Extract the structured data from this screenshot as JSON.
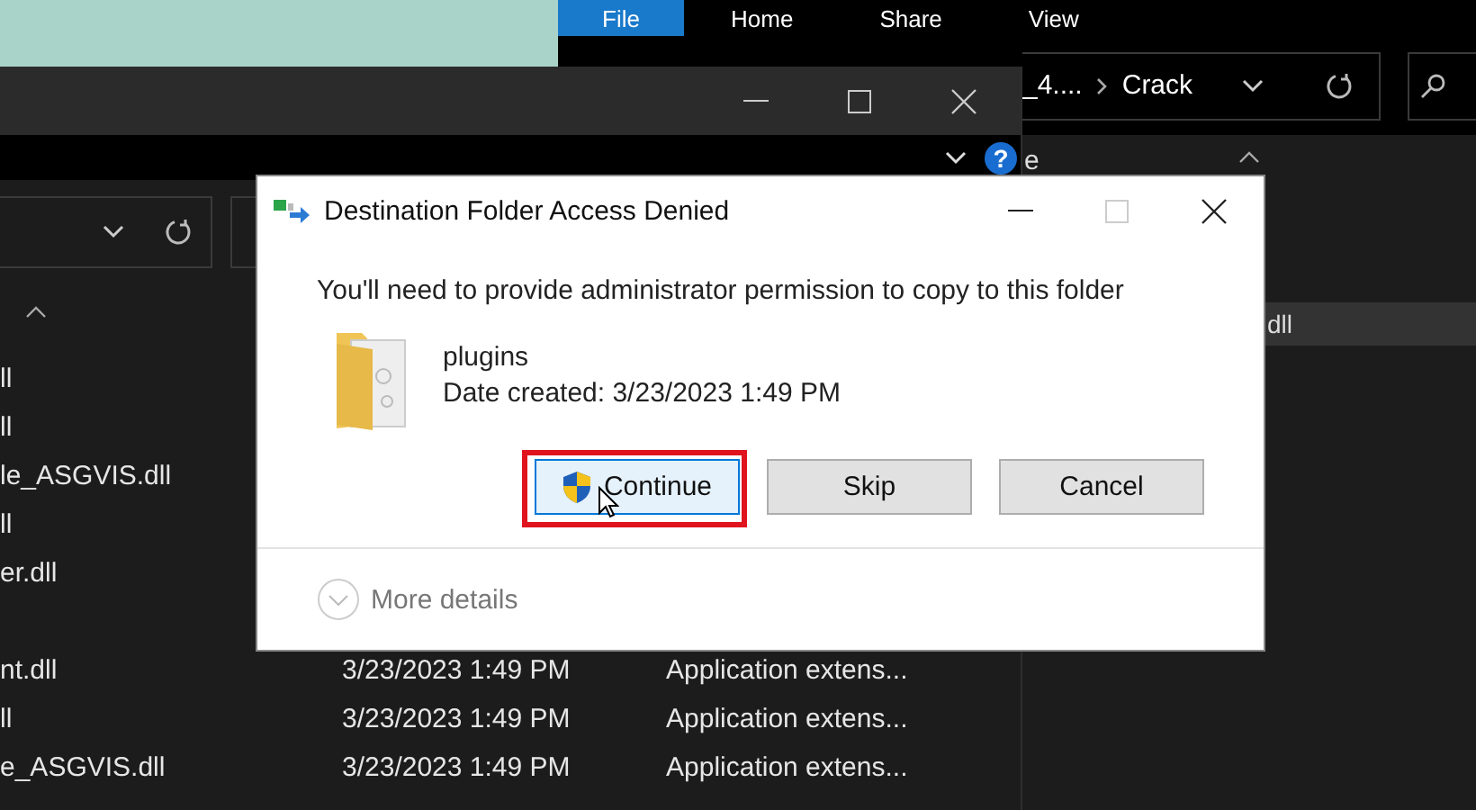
{
  "back_window": {
    "ribbon_tabs": [
      {
        "label": "File",
        "selected": true
      },
      {
        "label": "Home",
        "selected": false
      },
      {
        "label": "Share",
        "selected": false
      },
      {
        "label": "View",
        "selected": false
      }
    ],
    "address": [
      "_4....",
      "Crack"
    ],
    "help_button": "?",
    "column_fragment": "e",
    "items": [
      {
        "name": "dll",
        "selected": true
      }
    ]
  },
  "front_window": {
    "files": [
      {
        "name": "ll"
      },
      {
        "name": "ll"
      },
      {
        "name": "le_ASGVIS.dll"
      },
      {
        "name": "ll"
      },
      {
        "name": "er.dll"
      }
    ],
    "lower_files": [
      {
        "name": "nt.dll",
        "date": "3/23/2023 1:49 PM",
        "type": "Application extens..."
      },
      {
        "name": "ll",
        "date": "3/23/2023 1:49 PM",
        "type": "Application extens..."
      },
      {
        "name": "e_ASGVIS.dll",
        "date": "3/23/2023 1:49 PM",
        "type": "Application extens..."
      }
    ]
  },
  "dialog": {
    "title": "Destination Folder Access Denied",
    "message": "You'll need to provide administrator permission to copy to this folder",
    "folder_name": "plugins",
    "folder_date": "Date created: 3/23/2023 1:49 PM",
    "buttons": [
      {
        "label": "Continue",
        "kind": "elevated",
        "focused": true
      },
      {
        "label": "Skip",
        "kind": "plain",
        "focused": false
      },
      {
        "label": "Cancel",
        "kind": "plain",
        "focused": false
      }
    ],
    "more_details": "More details"
  }
}
